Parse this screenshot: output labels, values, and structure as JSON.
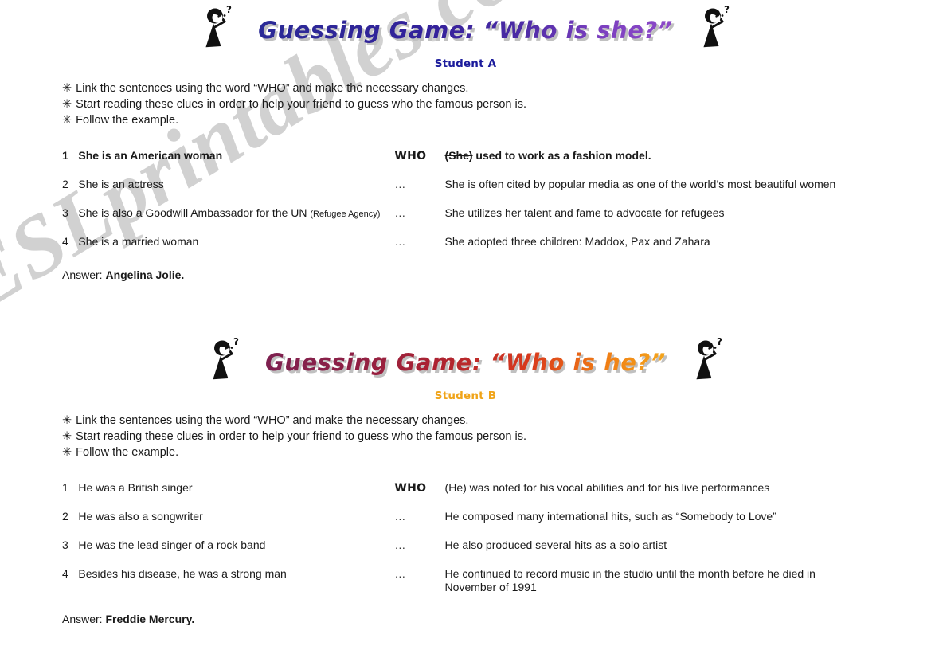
{
  "watermark": {
    "text": "ESLprintables.com"
  },
  "sections": [
    {
      "id": "student-a",
      "title": "Guessing Game: “Who is she?”",
      "student_label": "Student A",
      "title_color_start": "#2b2b96",
      "title_color_end": "#8e4ac9",
      "student_color": "#1c1c9c",
      "icon_left": "thinking-person-icon",
      "icon_right": "thinking-person-icon",
      "instructions": [
        "Link the sentences using the word “WHO” and make the necessary changes.",
        "Start reading these clues in order to help your friend to guess who the famous person is.",
        "Follow the example."
      ],
      "bullet_glyph": "✳",
      "rows": [
        {
          "num": "1",
          "left": "She is an American woman",
          "left_note": "",
          "connector": "WHO",
          "connector_type": "who",
          "right_struck": "(She)",
          "right": " used to work as a fashion model.",
          "bold": true
        },
        {
          "num": "2",
          "left": "She is an actress",
          "left_note": "",
          "connector": "…",
          "connector_type": "dots",
          "right_struck": "",
          "right": "She is often cited by popular media as one of the world’s most beautiful women",
          "bold": false
        },
        {
          "num": "3",
          "left": "She is also a Goodwill Ambassador for the UN ",
          "left_note": "(Refugee Agency)",
          "connector": "…",
          "connector_type": "dots",
          "right_struck": "",
          "right": "She utilizes her talent and fame to advocate for refugees",
          "bold": false
        },
        {
          "num": "4",
          "left": "She is a married woman",
          "left_note": "",
          "connector": "…",
          "connector_type": "dots",
          "right_struck": "",
          "right": "She adopted three children: Maddox, Pax and Zahara",
          "bold": false
        }
      ],
      "answer_label": "Answer:",
      "answer_name": "Angelina Jolie."
    },
    {
      "id": "student-b",
      "title": "Guessing Game: “Who is he?”",
      "student_label": "Student B",
      "title_color_start": "#7d2050",
      "title_color_end": "#f5a81c",
      "student_color": "#f0a419",
      "icon_left": "thinking-person-icon",
      "icon_right": "thinking-person-icon",
      "instructions": [
        "Link the sentences using the word “WHO” and make the necessary changes.",
        "Start reading these clues in order to help your friend to guess who the famous person is.",
        "Follow the example."
      ],
      "bullet_glyph": "✳",
      "rows": [
        {
          "num": "1",
          "left": "He was a British singer",
          "left_note": "",
          "connector": "WHO",
          "connector_type": "who",
          "right_struck": "(He)",
          "right": " was noted for his vocal abilities and for his live performances",
          "bold": false
        },
        {
          "num": "2",
          "left": "He was also a songwriter",
          "left_note": "",
          "connector": "…",
          "connector_type": "dots",
          "right_struck": "",
          "right": "He composed many international hits, such as “Somebody to Love”",
          "bold": false
        },
        {
          "num": "3",
          "left": "He was the lead singer of a rock band",
          "left_note": "",
          "connector": "…",
          "connector_type": "dots",
          "right_struck": "",
          "right": "He also produced several hits as a solo artist",
          "bold": false
        },
        {
          "num": "4",
          "left": "Besides his disease, he was a strong man",
          "left_note": "",
          "connector": "…",
          "connector_type": "dots",
          "right_struck": "",
          "right": "He continued to record music in the studio until the month before he died in November of 1991",
          "bold": false
        }
      ],
      "answer_label": "Answer:",
      "answer_name": "Freddie Mercury."
    }
  ]
}
